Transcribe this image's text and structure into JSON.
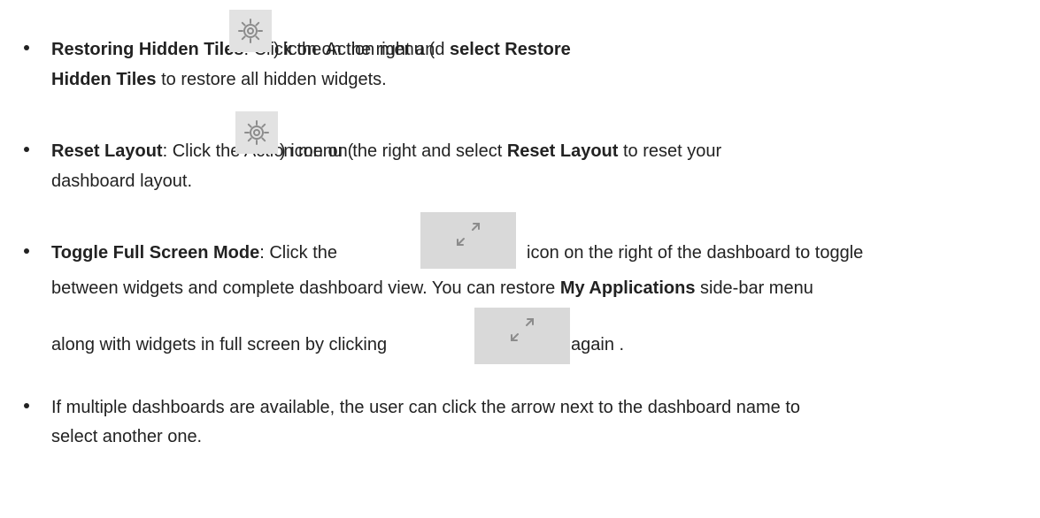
{
  "items": [
    {
      "title": "Restoring Hidden Tiles",
      "colon": ": ",
      "pre_icon": "Click the Action menu (",
      "icon": "gear-icon",
      "post_icon": ") icon on the right and ",
      "bold2": "select Restore",
      "line2_bold": "Hidden Tiles",
      "line2_rest": " to restore all hidden widgets."
    },
    {
      "title": "Reset Layout",
      "colon": ": ",
      "pre_icon": "Click the Action menu (",
      "icon": "gear-icon",
      "post_icon": ") icon on the right and select ",
      "bold2": "Reset Layout",
      "post_bold2": " to reset your",
      "line2_rest": "dashboard layout."
    },
    {
      "title": "Toggle Full Screen Mode",
      "colon": ": ",
      "pre_icon": "Click the ",
      "icon": "expand-icon",
      "post_icon": " icon on the right of the dashboard to toggle",
      "line2_pre": "between widgets and complete dashboard view. You can restore ",
      "line2_bold": "My Applications",
      "line2_post": " side-bar menu",
      "line3_pre": "along with widgets in full screen by clicking ",
      "line3_post": " again ."
    },
    {
      "line1": "If multiple dashboards are available, the user can click the arrow next to the dashboard name to",
      "line2": "select another one."
    }
  ]
}
